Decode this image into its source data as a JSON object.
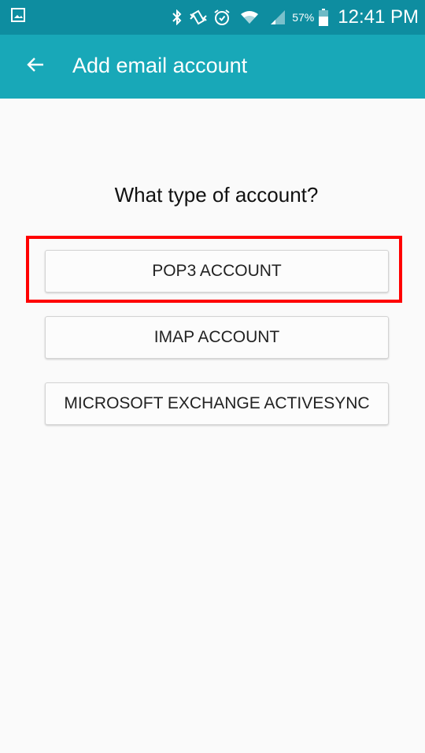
{
  "status_bar": {
    "battery_percent": "57%",
    "time": "12:41 PM",
    "icons": [
      "image-notification-icon",
      "bluetooth-icon",
      "vibrate-icon",
      "alarm-icon",
      "wifi-icon",
      "signal-icon",
      "battery-icon"
    ]
  },
  "app_bar": {
    "title": "Add email account",
    "back_icon": "arrow-back-icon"
  },
  "main": {
    "question": "What type of account?",
    "options": [
      {
        "label": "POP3 ACCOUNT",
        "highlighted": true
      },
      {
        "label": "IMAP ACCOUNT",
        "highlighted": false
      },
      {
        "label": "MICROSOFT EXCHANGE ACTIVESYNC",
        "highlighted": false
      }
    ]
  },
  "colors": {
    "status_bar": "#0e8da0",
    "app_bar": "#18a8b8",
    "background": "#fafafa",
    "highlight": "#ff0000"
  }
}
